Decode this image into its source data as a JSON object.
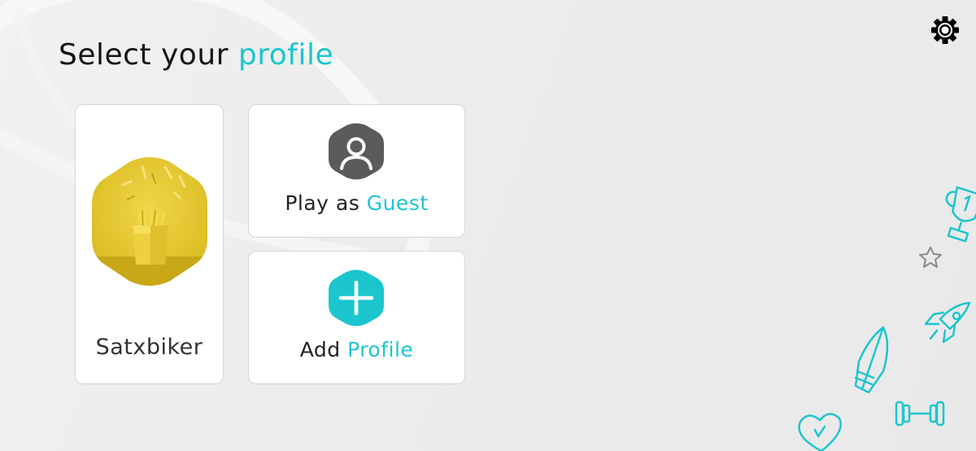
{
  "page": {
    "title_part1": "Select your ",
    "title_part2": "profile"
  },
  "profiles": [
    {
      "name": "Satxbiker",
      "avatar": "yellow-fries-avatar"
    }
  ],
  "guest_card": {
    "label_part1": "Play as ",
    "label_part2": "Guest",
    "icon": "user-icon"
  },
  "add_card": {
    "label_part1": "Add ",
    "label_part2": "Profile",
    "icon": "plus-icon"
  },
  "colors": {
    "accent": "#1cc6cf",
    "guest_icon_bg": "#5b5b5b",
    "avatar_yellow": "#e2c325",
    "background": "#ececec"
  },
  "icons": {
    "settings": "gear-icon",
    "decorations": [
      "trophy-icon",
      "star-icon",
      "rocket-icon",
      "surfboard-icon",
      "dumbbell-icon",
      "heart-icon"
    ]
  }
}
